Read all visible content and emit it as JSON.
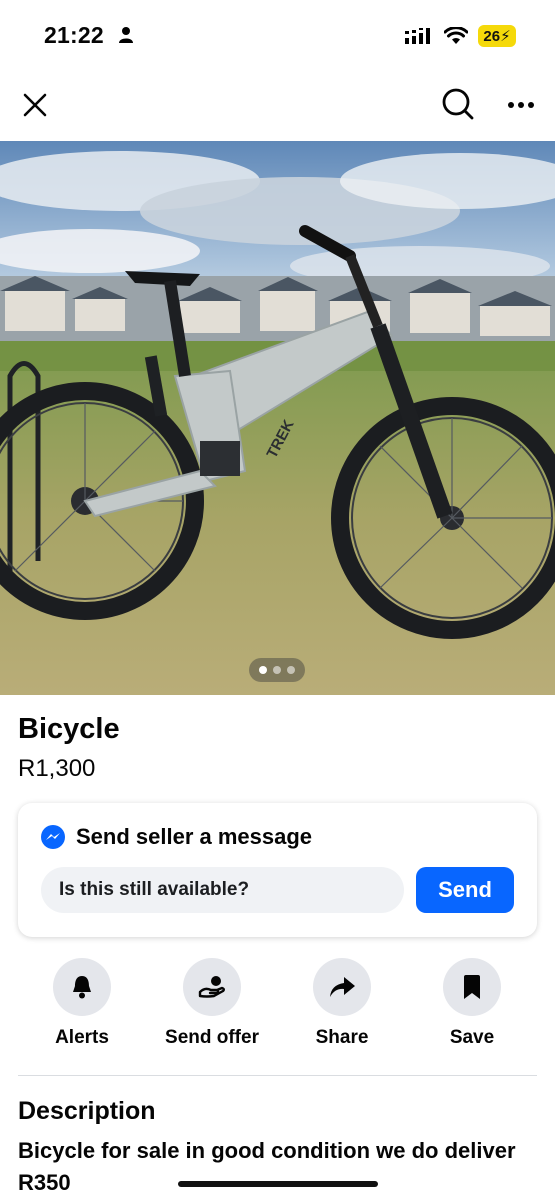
{
  "status_bar": {
    "time": "21:22",
    "battery": "26",
    "icons": [
      "person-icon",
      "cellular-signal-icon",
      "wifi-icon",
      "battery-charging-icon"
    ]
  },
  "top_bar": {
    "icons": [
      "close-icon",
      "search-icon",
      "more-icon"
    ]
  },
  "photo": {
    "pager": {
      "count": 3,
      "active": 1
    },
    "brand_text": "TREK"
  },
  "listing": {
    "title": "Bicycle",
    "price": "R1,300"
  },
  "message_card": {
    "heading": "Send seller a message",
    "input_value": "Is this still available?",
    "send_label": "Send",
    "icon": "messenger-icon",
    "accent": "#0866ff"
  },
  "actions": [
    {
      "label": "Alerts",
      "icon": "bell-icon"
    },
    {
      "label": "Send offer",
      "icon": "offer-hand-icon"
    },
    {
      "label": "Share",
      "icon": "share-arrow-icon"
    },
    {
      "label": "Save",
      "icon": "bookmark-icon"
    }
  ],
  "description": {
    "heading": "Description",
    "text": "Bicycle for sale in good condition we do deliver R350"
  }
}
